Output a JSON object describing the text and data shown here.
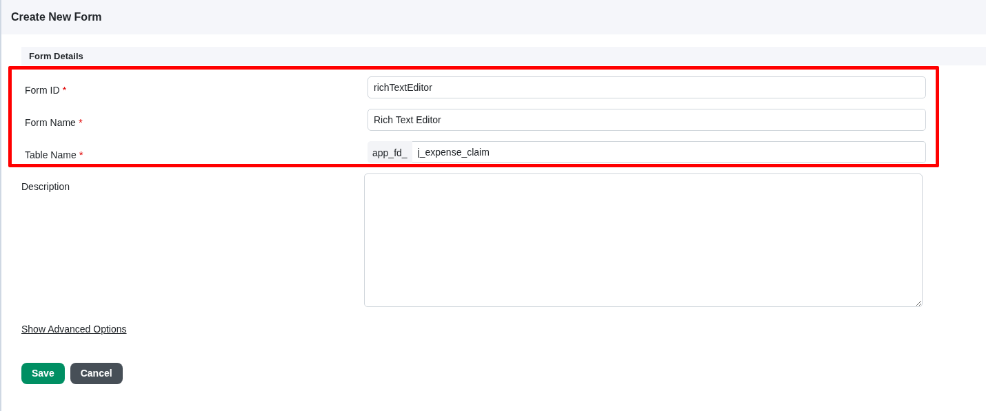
{
  "header": {
    "title": "Create New Form"
  },
  "section": {
    "title": "Form Details"
  },
  "fields": [
    {
      "kind": "text",
      "label": "Form ID",
      "required_marker": "*",
      "value": "richTextEditor",
      "highlighted": true
    },
    {
      "kind": "text",
      "label": "Form Name",
      "required_marker": "*",
      "value": "Rich Text Editor",
      "highlighted": true
    },
    {
      "kind": "prefixed",
      "label": "Table Name",
      "required_marker": "*",
      "prefix": "app_fd_",
      "value": "j_expense_claim",
      "highlighted": true
    },
    {
      "kind": "textarea",
      "label": "Description",
      "highlighted": false
    }
  ],
  "advanced_link": "Show Advanced Options",
  "buttons": [
    {
      "label": "Save",
      "kind": "primary"
    },
    {
      "label": "Cancel",
      "kind": "secondary"
    }
  ]
}
